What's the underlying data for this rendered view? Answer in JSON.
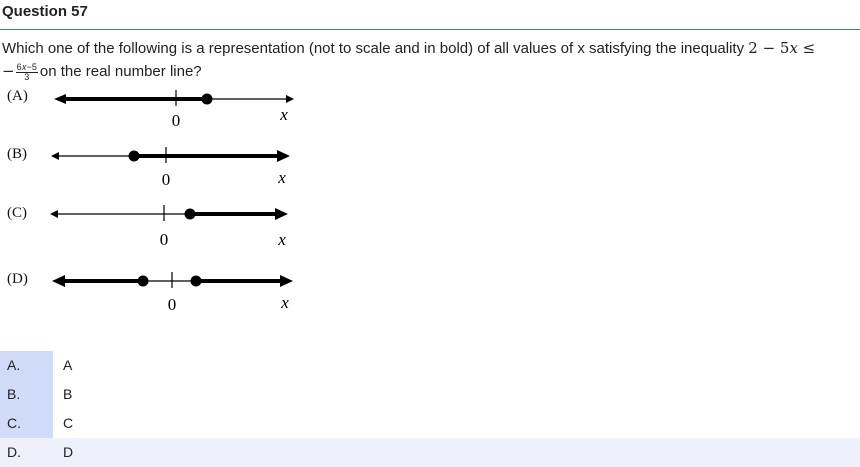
{
  "question": {
    "title": "Question 57",
    "stem_before": "Which one of the following is a representation (not to scale and in bold) of all values of x satisfying the inequality ",
    "inequality_lhs": "2 − 5𝑥 ≤",
    "inequality_sign": "−",
    "fraction_numerator": "6𝑥−5",
    "fraction_denominator": "3",
    "stem_after": "on the real number line?"
  },
  "options": [
    {
      "label": "(A)",
      "zero": "0",
      "var": "x"
    },
    {
      "label": "(B)",
      "zero": "0",
      "var": "x"
    },
    {
      "label": "(C)",
      "zero": "0",
      "var": "x"
    },
    {
      "label": "(D)",
      "zero": "0",
      "var": "x"
    }
  ],
  "answers": [
    {
      "letter": "A.",
      "text": "A",
      "selected": false
    },
    {
      "letter": "B.",
      "text": "B",
      "selected": false
    },
    {
      "letter": "C.",
      "text": "C",
      "selected": false
    },
    {
      "letter": "D.",
      "text": "D",
      "selected": true
    }
  ],
  "colors": {
    "accent_rule": "#2e8a8f",
    "answer_letter_bg": "#d0dcfa",
    "selected_row_bg": "#eef1fb"
  }
}
